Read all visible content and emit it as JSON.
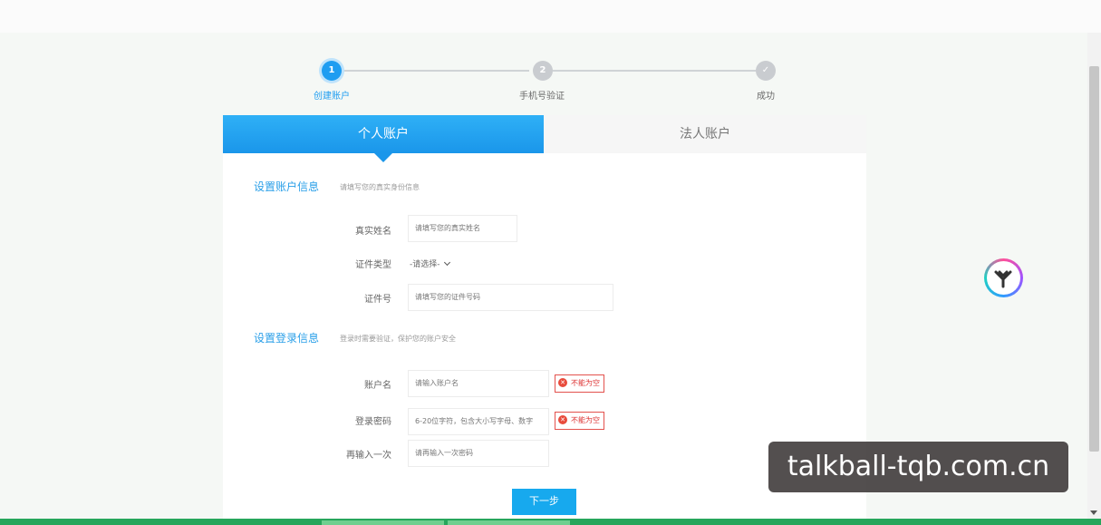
{
  "steps": [
    {
      "number": "1",
      "label": "创建账户",
      "state": "active"
    },
    {
      "number": "2",
      "label": "手机号验证",
      "state": "inactive"
    },
    {
      "number": "✓",
      "label": "成功",
      "state": "inactive"
    }
  ],
  "tabs": {
    "personal": "个人账户",
    "corporate": "法人账户"
  },
  "account_info": {
    "title": "设置账户信息",
    "hint": "请填写您的真实身份信息"
  },
  "fields": {
    "real_name": {
      "label": "真实姓名",
      "placeholder": "请填写您的真实姓名"
    },
    "id_type": {
      "label": "证件类型",
      "value": "-请选择-"
    },
    "id_number": {
      "label": "证件号",
      "placeholder": "请填写您的证件号码"
    },
    "account_name": {
      "label": "账户名",
      "placeholder": "请输入账户名",
      "error": "不能为空"
    },
    "password": {
      "label": "登录密码",
      "placeholder": "6-20位字符，包含大小写字母、数字",
      "error": "不能为空"
    },
    "password_confirm": {
      "label": "再输入一次",
      "placeholder": "请再输入一次密码"
    }
  },
  "login_info": {
    "title": "设置登录信息",
    "hint": "登录时需要验证，保护您的账户安全"
  },
  "next_button": "下一步",
  "watermark": "talkball-tqb.com.cn",
  "colors": {
    "accent": "#1e9df1",
    "error": "#e3514d",
    "button": "#17a9ee"
  }
}
